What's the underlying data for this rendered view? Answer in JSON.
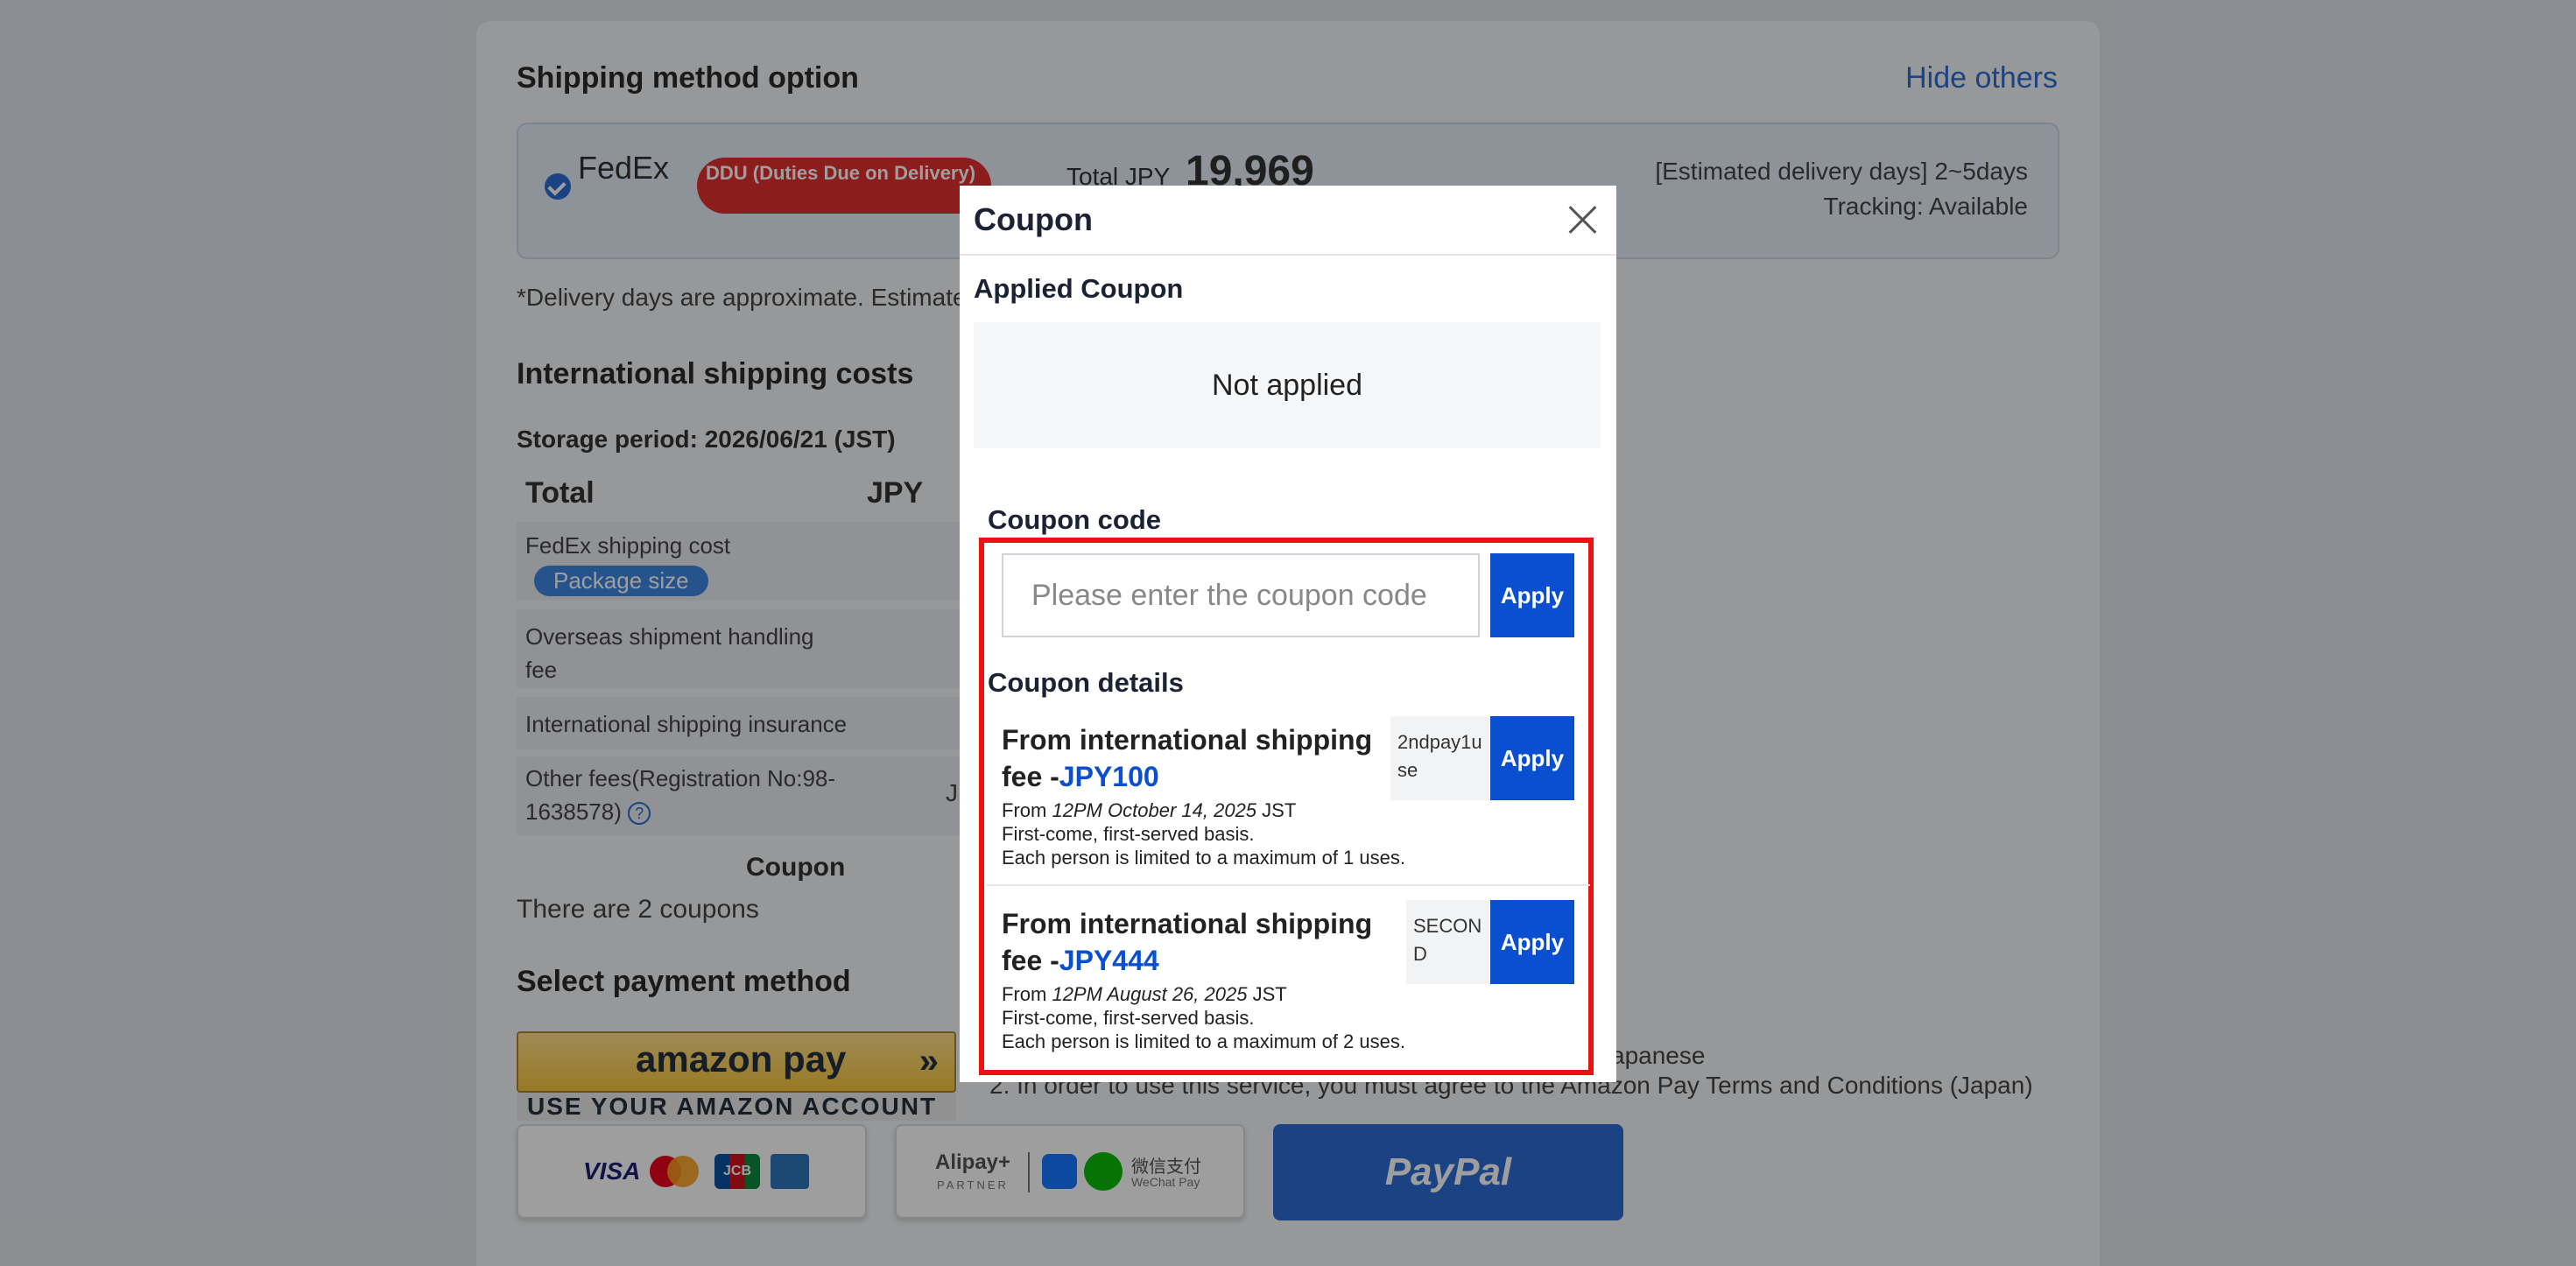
{
  "background": {
    "shipping_title": "Shipping method option",
    "hide_others": "Hide others",
    "carrier": "FedEx",
    "ddu_badge": "DDU (Duties Due on Delivery)",
    "total_label": "Total JPY",
    "total_value": "19,969",
    "est_days": "[Estimated delivery days] 2~5days",
    "tracking": "Tracking: Available",
    "delivery_note": "*Delivery days are approximate. Estimated",
    "intl_costs_title": "International shipping costs",
    "storage_period": "Storage period: 2026/06/21 (JST)",
    "table_total": "Total",
    "table_currency": "JPY",
    "rows": [
      {
        "label": "FedEx shipping cost"
      },
      {
        "label": "Overseas shipment handling fee"
      },
      {
        "label": "International shipping insurance"
      },
      {
        "label": "Other fees(Registration No:98-1638578)"
      }
    ],
    "package_size": "Package size",
    "coupon_label": "Coupon",
    "coupon_count": "There are 2 coupons",
    "payment_title": "Select payment method",
    "amazon_pay": "amazon pay",
    "amazon_sub": "USE YOUR AMAZON ACCOUNT",
    "note_1": "apanese",
    "note_2": "2. In order to use this service, you must agree to the Amazon Pay Terms and Conditions (Japan)",
    "cards": [
      "VISA",
      "JCB"
    ],
    "alipay": "Alipay+",
    "alipay_partner": "PARTNER",
    "wechat": "微信支付",
    "wechat_en": "WeChat Pay",
    "paypal": "PayPal",
    "currency_partial": "J"
  },
  "modal": {
    "title": "Coupon",
    "applied_title": "Applied Coupon",
    "not_applied": "Not applied",
    "code_title": "Coupon code",
    "code_placeholder": "Please enter the coupon code",
    "apply_label": "Apply",
    "details_title": "Coupon details",
    "coupons": [
      {
        "title_prefix": "From international shipping fee -",
        "amount": "JPY100",
        "from_label": "From",
        "from_time": "12PM October 14, 2025",
        "from_tz": "JST",
        "basis": "First-come, first-served basis.",
        "limit": "Each person is limited to a maximum of 1 uses.",
        "code": "2ndpay1use"
      },
      {
        "title_prefix": "From international shipping fee -",
        "amount": "JPY444",
        "from_label": "From",
        "from_time": "12PM August 26, 2025",
        "from_tz": "JST",
        "basis": "First-come, first-served basis.",
        "limit": "Each person is limited to a maximum of 2 uses.",
        "code": "SECOND"
      }
    ]
  },
  "colors": {
    "accent": "#0b4fd1",
    "highlight_frame": "#ee1111",
    "ddu_badge": "#e03030"
  }
}
